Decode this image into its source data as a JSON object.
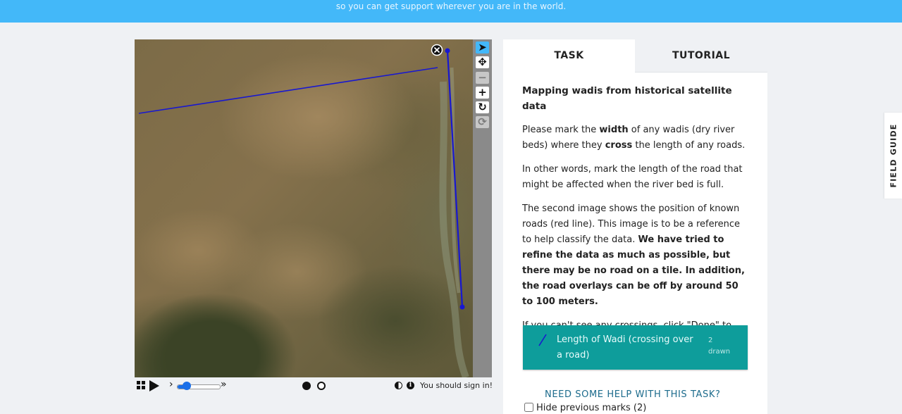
{
  "banner": {
    "text": "so you can get support wherever you are in the world."
  },
  "viewer": {
    "colors": {
      "mark": "#1818d0",
      "toolbar_active": "#43b8f9"
    },
    "tools": [
      {
        "name": "pointer-icon",
        "glyph": "➤",
        "state": "active"
      },
      {
        "name": "pan-icon",
        "glyph": "✥",
        "state": "normal"
      },
      {
        "name": "zoom-out-icon",
        "glyph": "−",
        "state": "disabled"
      },
      {
        "name": "zoom-in-icon",
        "glyph": "+",
        "state": "normal"
      },
      {
        "name": "rotate-icon",
        "glyph": "↻",
        "state": "normal"
      },
      {
        "name": "reset-icon",
        "glyph": "⟳",
        "state": "disabled"
      }
    ],
    "signin_text": "You should sign in!"
  },
  "panel": {
    "tabs": {
      "task": "TASK",
      "tutorial": "TUTORIAL"
    },
    "heading": "Mapping wadis from historical satellite data",
    "para1": {
      "a": "Please mark the ",
      "b": "width",
      "c": " of any wadis (dry river beds) where they ",
      "d": "cross",
      "e": " the length of any roads."
    },
    "para2": "In other words, mark the length of the road that might be affected when the river bed is full.",
    "para3": {
      "a": "The second image shows the position of known roads (red line). This image is to be a reference to help classify the data. ",
      "b": "We have tried to refine the data as much as possible, but there may be no road on a tile. In addition, the road overlays can be off by around 50 to 100 meters."
    },
    "para4": "If you can't see any crossings, click \"Done\" to move on to the next image.",
    "tool_button": {
      "label": "Length of Wadi (crossing over a road)",
      "count": "2",
      "count_suffix": "drawn",
      "color": "#0e9d9b"
    },
    "help_link": "NEED SOME HELP WITH THIS TASK?",
    "hide_marks": "Hide previous marks (2)"
  },
  "field_guide": "FIELD GUIDE"
}
